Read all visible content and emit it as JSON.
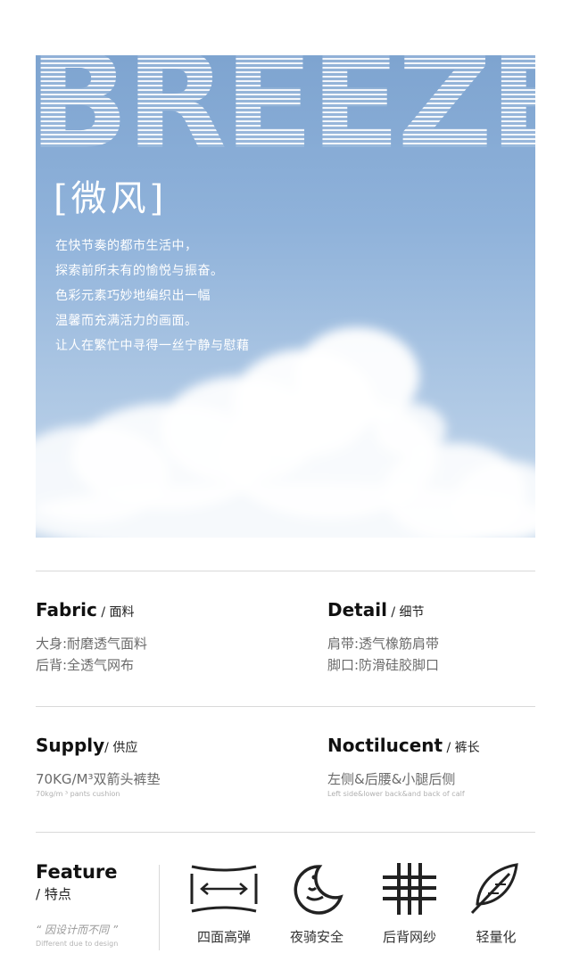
{
  "hero": {
    "big_word": "BREEZE",
    "title": "[微风]",
    "lines": [
      "在快节奏的都市生活中，",
      "探索前所未有的愉悦与振奋。",
      "色彩元素巧妙地编织出一幅",
      "温馨而充满活力的画面。",
      "让人在繁忙中寻得一丝宁静与慰藉"
    ]
  },
  "specs": {
    "fabric": {
      "title": "Fabric",
      "zh": " / 面料",
      "lines": [
        "大身:耐磨透气面料",
        "后背:全透气网布"
      ]
    },
    "detail": {
      "title": "Detail",
      "zh": "  / 细节",
      "lines": [
        "肩带:透气橡筋肩带",
        "脚口:防滑硅胶脚口"
      ]
    },
    "supply": {
      "title": "Supply",
      "zh": "/ 供应",
      "line": "70KG/M³双箭头裤垫",
      "small": "70kg/m ³ pants cushion"
    },
    "noctilucent": {
      "title": "Noctilucent",
      "zh": " / 裤长",
      "line": "左侧&后腰&小腿后侧",
      "small": "Left side&lower back&and back of calf"
    }
  },
  "feature": {
    "title": "Feature",
    "sub": "/ 特点",
    "quote": "“ 因设计而不同 ”",
    "quote_en": "Different due to design",
    "items": [
      {
        "icon": "four-way-stretch-icon",
        "label": "四面高弹"
      },
      {
        "icon": "moon-night-icon",
        "label": "夜骑安全"
      },
      {
        "icon": "mesh-grid-icon",
        "label": "后背网纱"
      },
      {
        "icon": "feather-icon",
        "label": "轻量化"
      }
    ]
  },
  "colors": {
    "sky_top": "#7ea4d0",
    "sky_bottom": "#c5d8ec",
    "rule": "#d9d9d9"
  }
}
